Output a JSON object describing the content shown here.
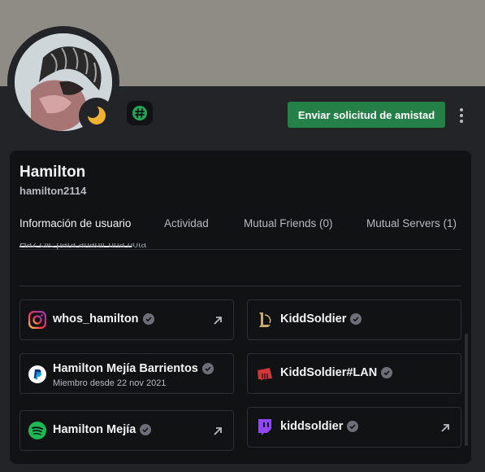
{
  "profile": {
    "display_name": "Hamilton",
    "username": "hamilton2114",
    "status": "idle"
  },
  "actions": {
    "add_friend_label": "Enviar solicitud de amistad"
  },
  "tabs": [
    {
      "label": "Información de usuario",
      "active": true
    },
    {
      "label": "Actividad",
      "active": false
    },
    {
      "label": "Mutual Friends (0)",
      "active": false
    },
    {
      "label": "Mutual Servers (1)",
      "active": false
    }
  ],
  "note": {
    "placeholder": "Haz clic para añadir una nota"
  },
  "connections": [
    {
      "platform": "instagram",
      "icon": "instagram-icon",
      "name": "whos_hamilton",
      "verified": true,
      "external_link": true
    },
    {
      "platform": "league-of-legends",
      "icon": "league-of-legends-icon",
      "name": "KiddSoldier",
      "verified": true,
      "external_link": false
    },
    {
      "platform": "paypal",
      "icon": "paypal-icon",
      "name": "Hamilton Mejía Barrientos",
      "subtitle": "Miembro desde 22 nov 2021",
      "verified": true,
      "external_link": false
    },
    {
      "platform": "riot-games",
      "icon": "riot-games-icon",
      "name": "KiddSoldier#LAN",
      "verified": true,
      "external_link": false
    },
    {
      "platform": "spotify",
      "icon": "spotify-icon",
      "name": "Hamilton Mejía",
      "verified": true,
      "external_link": true
    },
    {
      "platform": "twitch",
      "icon": "twitch-icon",
      "name": "kiddsoldier",
      "verified": true,
      "external_link": true
    }
  ],
  "colors": {
    "banner": "#8f8c86",
    "background": "#232428",
    "card": "#111214",
    "button_green": "#248046",
    "status_idle": "#f0b232",
    "spotify": "#1db954",
    "twitch": "#9146ff",
    "riot": "#d13639",
    "lol_gold": "#c8aa6e"
  }
}
